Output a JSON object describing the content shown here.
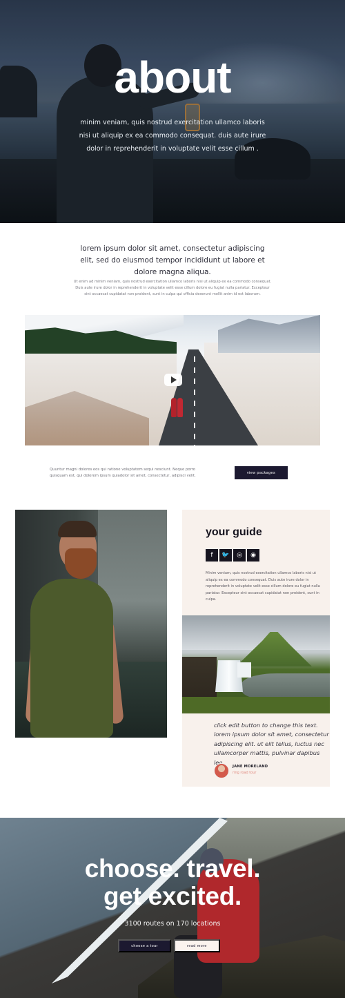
{
  "hero": {
    "title": "about",
    "text": "minim veniam, quis nostrud exercitation ullamco laboris nisi ut aliquip ex ea commodo consequat. duis aute irure dolor in reprehenderit in voluptate velit esse cillum ."
  },
  "intro": {
    "lead": "lorem ipsum dolor sit amet, consectetur adipiscing elit, sed do eiusmod tempor incididunt ut labore et dolore magna aliqua.",
    "small": "Ut enim ad minim veniam, quis nostrud exercitation ullamco laboris nisi ut aliquip ex ea commodo consequat. Duis aute irure dolor in reprehenderit in voluptate velit esse cillum dolore eu fugiat nulla pariatur. Excepteur sint occaecat cupidatat non proident, sunt in culpa qui officia deserunt mollit anim id est laborum."
  },
  "video": {
    "play_icon": "play-icon"
  },
  "cta": {
    "text": "Quuntur magni dolores eos qui ratione voluptatem sequi nesciunt. Neque porro quisquam est, qui dolorem ipsum quiadolor sit amet, consectetur, adipisci velit.",
    "button": "view packages"
  },
  "guide": {
    "title": "your guide",
    "social": [
      {
        "icon": "facebook-icon",
        "glyph": "f"
      },
      {
        "icon": "twitter-icon",
        "glyph": "🐦"
      },
      {
        "icon": "instagram-icon",
        "glyph": "◎"
      },
      {
        "icon": "website-icon",
        "glyph": "◉"
      }
    ],
    "text": "Minim veniam, quis nostrud exercitation ullamco laboris nisi ut aliquip ex ea commodo consequat. Duis aute irure dolor in reprehenderit in voluptate velit esse cillum dolore eu fugiat nulla pariatur. Excepteur sint occaecat cupidatat non proident, sunt in culpa.",
    "quote": "click edit button to change this text. lorem ipsum dolor sit amet, consectetur adipiscing elit. ut elit tellus, luctus nec ullamcorper mattis, pulvinar dapibus leo.",
    "author_name": "JANE MORELAND",
    "author_role": "ring road tour"
  },
  "bottom": {
    "title_line1": "choose. travel.",
    "title_line2": "get excited.",
    "subtitle": "3100 routes on 170 locations",
    "btn_tour": "choose a tour",
    "btn_more": "read more"
  },
  "colors": {
    "dark": "#1c1930",
    "cream": "#f8f1ec",
    "accent": "#e0897f"
  }
}
